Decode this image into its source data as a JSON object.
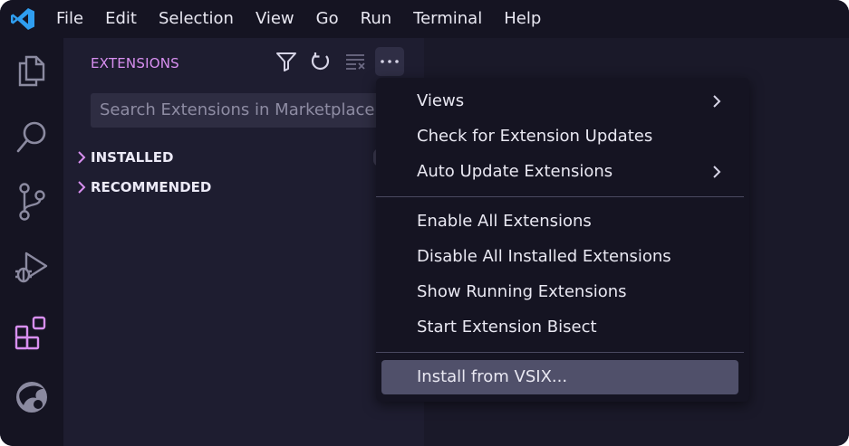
{
  "colors": {
    "window_bg": "#1e1d30",
    "titlebar_bg": "#151422",
    "accent": "#d88ff0",
    "logo_blue": "#2f9ef0",
    "menu_selected_bg": "#50506a"
  },
  "menubar": {
    "items": [
      {
        "label": "File",
        "name": "menu-file"
      },
      {
        "label": "Edit",
        "name": "menu-edit"
      },
      {
        "label": "Selection",
        "name": "menu-selection"
      },
      {
        "label": "View",
        "name": "menu-view"
      },
      {
        "label": "Go",
        "name": "menu-go"
      },
      {
        "label": "Run",
        "name": "menu-run"
      },
      {
        "label": "Terminal",
        "name": "menu-terminal"
      },
      {
        "label": "Help",
        "name": "menu-help"
      }
    ]
  },
  "activitybar": {
    "icons": [
      "files-icon",
      "search-icon",
      "source-control-icon",
      "run-debug-icon",
      "extensions-icon",
      "account-globe-icon"
    ]
  },
  "sidebar": {
    "title": "EXTENSIONS",
    "actions": [
      "filter-icon",
      "refresh-icon",
      "clear-icon",
      "more-actions-icon"
    ],
    "search": {
      "placeholder": "Search Extensions in Marketplace"
    },
    "sections": [
      {
        "label": "INSTALLED",
        "expanded": false
      },
      {
        "label": "RECOMMENDED",
        "expanded": false
      }
    ]
  },
  "context_menu": {
    "groups": [
      [
        {
          "label": "Views",
          "submenu": true
        },
        {
          "label": "Check for Extension Updates",
          "submenu": false
        },
        {
          "label": "Auto Update Extensions",
          "submenu": true
        }
      ],
      [
        {
          "label": "Enable All Extensions",
          "submenu": false
        },
        {
          "label": "Disable All Installed Extensions",
          "submenu": false
        },
        {
          "label": "Show Running Extensions",
          "submenu": false
        },
        {
          "label": "Start Extension Bisect",
          "submenu": false
        }
      ],
      [
        {
          "label": "Install from VSIX...",
          "submenu": false,
          "selected": true
        }
      ]
    ]
  }
}
